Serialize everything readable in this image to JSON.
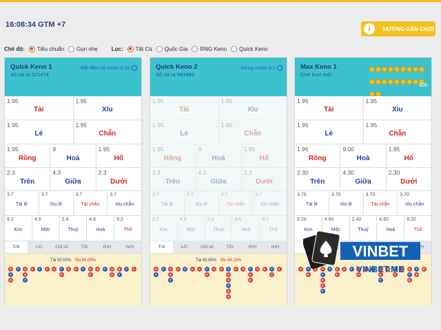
{
  "clock": "16:08:34 GTM +7",
  "guide_button": "HƯỚNG DẪN CHƠI",
  "filters": {
    "mode_label": "Chế độ:",
    "modes": [
      {
        "label": "Tiêu chuẩn",
        "selected": true
      },
      {
        "label": "Gọn nhẹ",
        "selected": false
      }
    ],
    "filter_label": "Lọc:",
    "options": [
      {
        "label": "Tất Cả",
        "selected": true
      },
      {
        "label": "Quốc Gia",
        "selected": false
      },
      {
        "label": "RNG Keno",
        "selected": false
      },
      {
        "label": "Quick Keno",
        "selected": false
      }
    ]
  },
  "panels": [
    {
      "name": "Quick Keno 1",
      "sub": "Số rút ra 521474",
      "status": "Bắt đầu cá cược 0:15",
      "rows": [
        [
          {
            "o": "1.95",
            "l": "Tài",
            "c": "red"
          },
          {
            "o": "1.95",
            "l": "Xỉu",
            "c": "blue"
          }
        ],
        [
          {
            "o": "1.95",
            "l": "Lẻ",
            "c": "blue"
          },
          {
            "o": "1.95",
            "l": "Chẵn",
            "c": "red"
          }
        ],
        [
          {
            "o": "1.95",
            "l": "Rồng",
            "c": "red"
          },
          {
            "o": "9",
            "l": "Hoà",
            "c": "blue"
          },
          {
            "o": "1.95",
            "l": "Hổ",
            "c": "red"
          }
        ],
        [
          {
            "o": "2.3",
            "l": "Trên",
            "c": "blue"
          },
          {
            "o": "4.3",
            "l": "Giữa",
            "c": "blue"
          },
          {
            "o": "2.3",
            "l": "Dưới",
            "c": "red"
          }
        ],
        [
          {
            "o": "3.7",
            "l": "Tài lẻ",
            "c": "blue"
          },
          {
            "o": "3.7",
            "l": "Xỉu lẻ",
            "c": "blue"
          },
          {
            "o": "3.7",
            "l": "Tài chẵn",
            "c": "red"
          },
          {
            "o": "3.7",
            "l": "Xỉu chẵn",
            "c": "blue"
          }
        ],
        [
          {
            "o": "9.2",
            "l": "Kim",
            "c": "blue"
          },
          {
            "o": "4.6",
            "l": "Mộc",
            "c": "blue"
          },
          {
            "o": "2.4",
            "l": "Thuỷ",
            "c": "blue"
          },
          {
            "o": "4.6",
            "l": "Hoả",
            "c": "blue"
          },
          {
            "o": "9.2",
            "l": "Thổ",
            "c": "red"
          }
        ]
      ],
      "tai_pct": "Tài 50.00%",
      "xiu_pct": "Xỉu 50.00%"
    },
    {
      "name": "Quick Keno 2",
      "sub": "Số rút ra 591969",
      "status": "Dừng cược 0:1",
      "rows": [
        [
          {
            "o": "1.95",
            "l": "Tài",
            "c": "red"
          },
          {
            "o": "1.95",
            "l": "Xỉu",
            "c": "blue"
          }
        ],
        [
          {
            "o": "1.95",
            "l": "Lẻ",
            "c": "blue"
          },
          {
            "o": "1.95",
            "l": "Chẵn",
            "c": "red"
          }
        ],
        [
          {
            "o": "1.95",
            "l": "Rồng",
            "c": "red"
          },
          {
            "o": "9",
            "l": "Hoà",
            "c": "blue"
          },
          {
            "o": "1.95",
            "l": "Hổ",
            "c": "red"
          }
        ],
        [
          {
            "o": "2.3",
            "l": "Trên",
            "c": "blue"
          },
          {
            "o": "4.3",
            "l": "Giữa",
            "c": "blue"
          },
          {
            "o": "2.3",
            "l": "Dưới",
            "c": "red"
          }
        ],
        [
          {
            "o": "3.7",
            "l": "Tài lẻ",
            "c": "blue"
          },
          {
            "o": "3.7",
            "l": "Xỉu lẻ",
            "c": "blue"
          },
          {
            "o": "3.7",
            "l": "Tài chẵn",
            "c": "red"
          },
          {
            "o": "3.7",
            "l": "Xỉu chẵn",
            "c": "blue"
          }
        ],
        [
          {
            "o": "9.2",
            "l": "Kim",
            "c": "blue"
          },
          {
            "o": "4.6",
            "l": "Mộc",
            "c": "blue"
          },
          {
            "o": "2.4",
            "l": "Thuỷ",
            "c": "blue"
          },
          {
            "o": "4.6",
            "l": "Hoả",
            "c": "blue"
          },
          {
            "o": "9.2",
            "l": "Thổ",
            "c": "red"
          }
        ]
      ],
      "tai_pct": "Tài 65.85%",
      "xiu_pct": "Xỉu 34.15%"
    },
    {
      "name": "Max Keno 1",
      "sub": "Chờ lượt mới",
      "status": "",
      "rows": [
        [
          {
            "o": "1.95",
            "l": "Tài",
            "c": "red"
          },
          {
            "o": "1.95",
            "l": "Xỉu",
            "c": "blue"
          }
        ],
        [
          {
            "o": "1.95",
            "l": "Lẻ",
            "c": "blue"
          },
          {
            "o": "1.95",
            "l": "Chẵn",
            "c": "red"
          }
        ],
        [
          {
            "o": "1.95",
            "l": "Rồng",
            "c": "red"
          },
          {
            "o": "9.00",
            "l": "Hoà",
            "c": "blue"
          },
          {
            "o": "1.95",
            "l": "Hổ",
            "c": "red"
          }
        ],
        [
          {
            "o": "2.30",
            "l": "Trên",
            "c": "blue"
          },
          {
            "o": "4.30",
            "l": "Giữa",
            "c": "blue"
          },
          {
            "o": "2.30",
            "l": "Dưới",
            "c": "red"
          }
        ],
        [
          {
            "o": "3.70",
            "l": "Tài lẻ",
            "c": "blue"
          },
          {
            "o": "3.70",
            "l": "Xỉu lẻ",
            "c": "blue"
          },
          {
            "o": "3.70",
            "l": "Tài chẵn",
            "c": "red"
          },
          {
            "o": "3.70",
            "l": "Xỉu chẵn",
            "c": "blue"
          }
        ],
        [
          {
            "o": "9.20",
            "l": "Kim",
            "c": "blue"
          },
          {
            "o": "4.60",
            "l": "Mộc",
            "c": "blue"
          },
          {
            "o": "2.40",
            "l": "Thuỷ",
            "c": "blue"
          },
          {
            "o": "4.60",
            "l": "Hoả",
            "c": "blue"
          },
          {
            "o": "9.20",
            "l": "Thổ",
            "c": "red"
          }
        ]
      ],
      "tai_pct": "",
      "xiu_pct": "",
      "draw_count": "828"
    }
  ],
  "tabs": [
    "T/X",
    "L/C",
    "Chỉ số",
    "T/D",
    "R/H",
    "N/H"
  ],
  "watermark": {
    "brand": "VINBET",
    "site": "VINBET.ME"
  }
}
